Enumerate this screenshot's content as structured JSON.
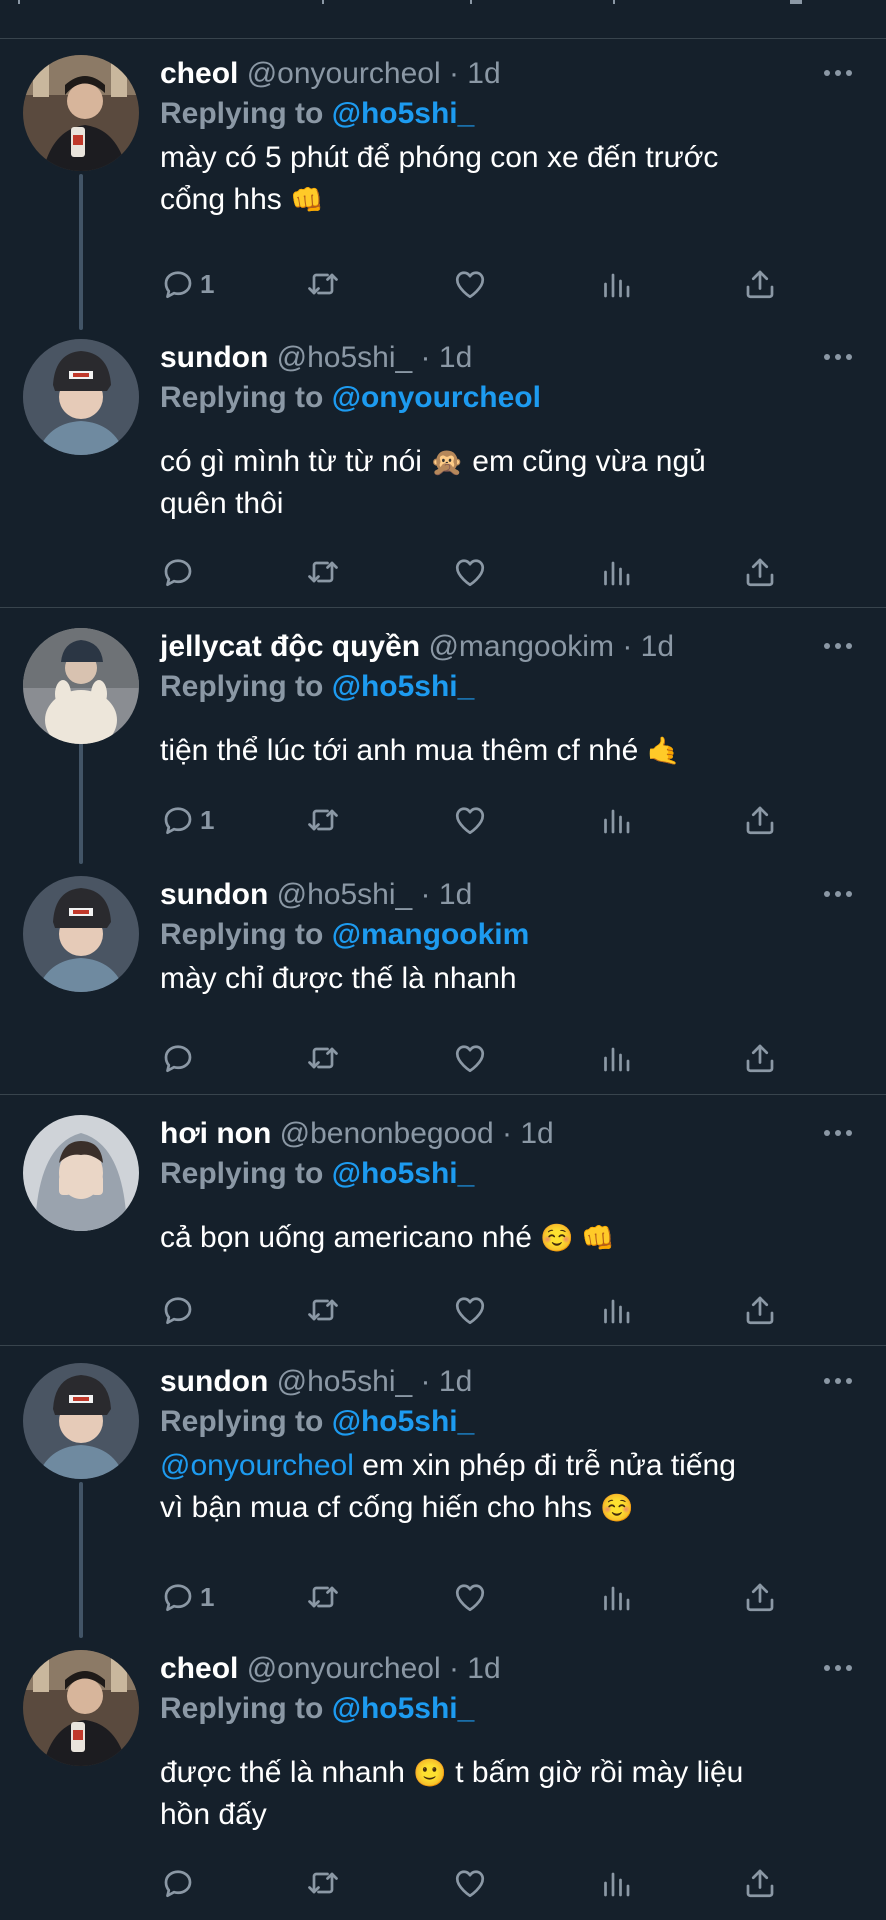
{
  "tweets": [
    {
      "name": "cheol",
      "handle": "@onyourcheol",
      "time": "1d",
      "replying_label": "Replying to",
      "reply_to": "@ho5shi_",
      "text_mention": "",
      "text_line1": "mày có 5 phút để phóng con xe đến trước",
      "text_line2": "cổng hhs",
      "emoji_line2": "👊",
      "reply_count": "1"
    },
    {
      "name": "sundon",
      "handle": "@ho5shi_",
      "time": "1d",
      "replying_label": "Replying to",
      "reply_to": "@onyourcheol",
      "text_line1": "có gì mình từ từ nói",
      "emoji_line1": "🙊",
      "text_line1b": "em cũng vừa ngủ",
      "text_line2": "quên thôi",
      "reply_count": ""
    },
    {
      "name": "jellycat độc quyền",
      "handle": "@mangookim",
      "time": "1d",
      "replying_label": "Replying to",
      "reply_to": "@ho5shi_",
      "text_line1": "tiện thể lúc tới anh mua thêm cf nhé",
      "emoji_line1": "🤙",
      "reply_count": "1"
    },
    {
      "name": "sundon",
      "handle": "@ho5shi_",
      "time": "1d",
      "replying_label": "Replying to",
      "reply_to": "@mangookim",
      "text_line1": "mày chỉ được thế là nhanh",
      "reply_count": ""
    },
    {
      "name": "hơi non",
      "handle": "@benonbegood",
      "time": "1d",
      "replying_label": "Replying to",
      "reply_to": "@ho5shi_",
      "text_line1": "cả bọn uống americano nhé",
      "emoji_line1": "☺️ 👊",
      "reply_count": ""
    },
    {
      "name": "sundon",
      "handle": "@ho5shi_",
      "time": "1d",
      "replying_label": "Replying to",
      "reply_to": "@ho5shi_",
      "text_mention": "@onyourcheol",
      "text_line1": "em xin phép đi trễ nửa tiếng",
      "text_line2": "vì bận mua cf cống hiến cho hhs",
      "emoji_line2": "☺️",
      "reply_count": "1"
    },
    {
      "name": "cheol",
      "handle": "@onyourcheol",
      "time": "1d",
      "replying_label": "Replying to",
      "reply_to": "@ho5shi_",
      "text_line1": "được thế là nhanh",
      "emoji_line1": "🙂",
      "text_line1b": "t bấm giờ rồi mày liệu",
      "text_line2": "hồn đấy",
      "reply_count": ""
    }
  ],
  "separator": "·",
  "colors": {
    "background": "#15202b",
    "divider": "#38444d",
    "secondary_text": "#8b98a5",
    "link": "#1d9bf0",
    "thread_line": "#425466"
  },
  "icons": [
    "reply-icon",
    "retweet-icon",
    "like-icon",
    "analytics-icon",
    "share-icon",
    "more-icon"
  ]
}
